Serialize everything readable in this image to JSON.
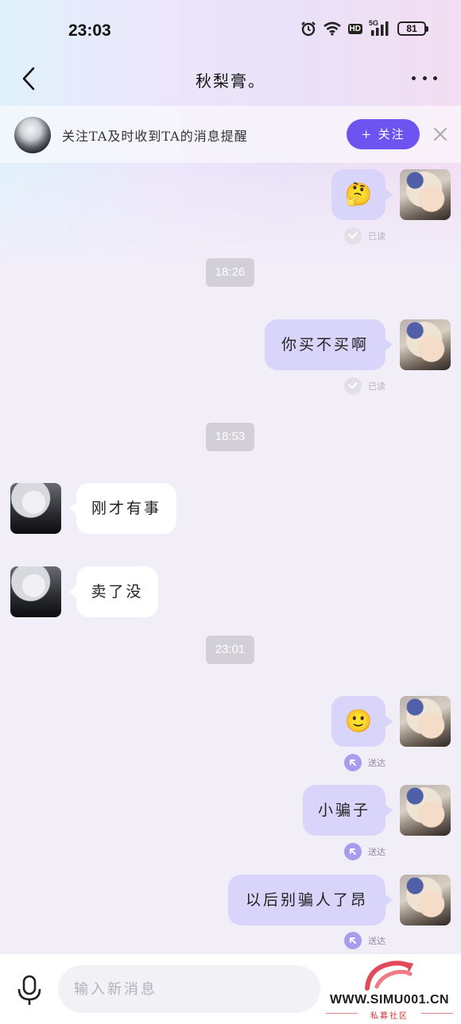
{
  "status_bar": {
    "time": "23:03",
    "network": "5G",
    "hd": "HD",
    "battery": "81"
  },
  "header": {
    "title": "秋梨膏。"
  },
  "follow_banner": {
    "text": "关注TA及时收到TA的消息提醒",
    "button_label": "+ 关注"
  },
  "messages": [
    {
      "from": "me",
      "content": "🤔",
      "status": "已读"
    },
    {
      "timestamp": "18:26"
    },
    {
      "from": "me",
      "content": "你买不买啊",
      "status": "已读"
    },
    {
      "timestamp": "18:53"
    },
    {
      "from": "them",
      "content": "刚才有事"
    },
    {
      "from": "them",
      "content": "卖了没"
    },
    {
      "timestamp": "23:01"
    },
    {
      "from": "me",
      "content": "🙂",
      "status": "送达"
    },
    {
      "from": "me",
      "content": "小骗子",
      "status": "送达"
    },
    {
      "from": "me",
      "content": "以后别骗人了昂",
      "status": "送达"
    }
  ],
  "input": {
    "placeholder": "输入新消息"
  },
  "watermark": {
    "text": "WWW.SIMU001.CN",
    "subtitle": "私募社区"
  },
  "colors": {
    "accent": "#6d54f0",
    "my_bubble": "#d8d4fa",
    "their_bubble": "#ffffff",
    "timestamp_bg": "#d2cfd8"
  }
}
